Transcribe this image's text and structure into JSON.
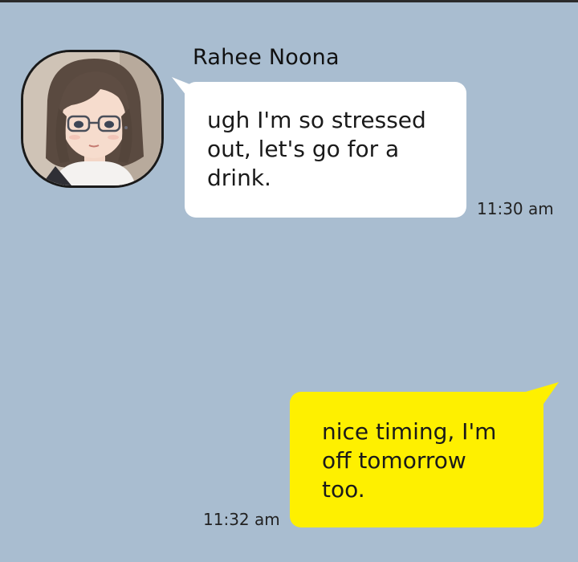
{
  "conversation": {
    "incoming": {
      "sender": "Rahee Noona",
      "lines": [
        "ugh I'm so stressed",
        "out, let's go for a",
        "drink."
      ],
      "time": "11:30 am"
    },
    "outgoing": {
      "lines": [
        "nice timing, I'm",
        "off tomorrow",
        "too."
      ],
      "time": "11:32 am"
    }
  },
  "colors": {
    "background": "#a9bdd0",
    "incoming_bubble": "#ffffff",
    "outgoing_bubble": "#fef000"
  },
  "icons": {
    "avatar": "profile-avatar-woman-with-glasses"
  }
}
